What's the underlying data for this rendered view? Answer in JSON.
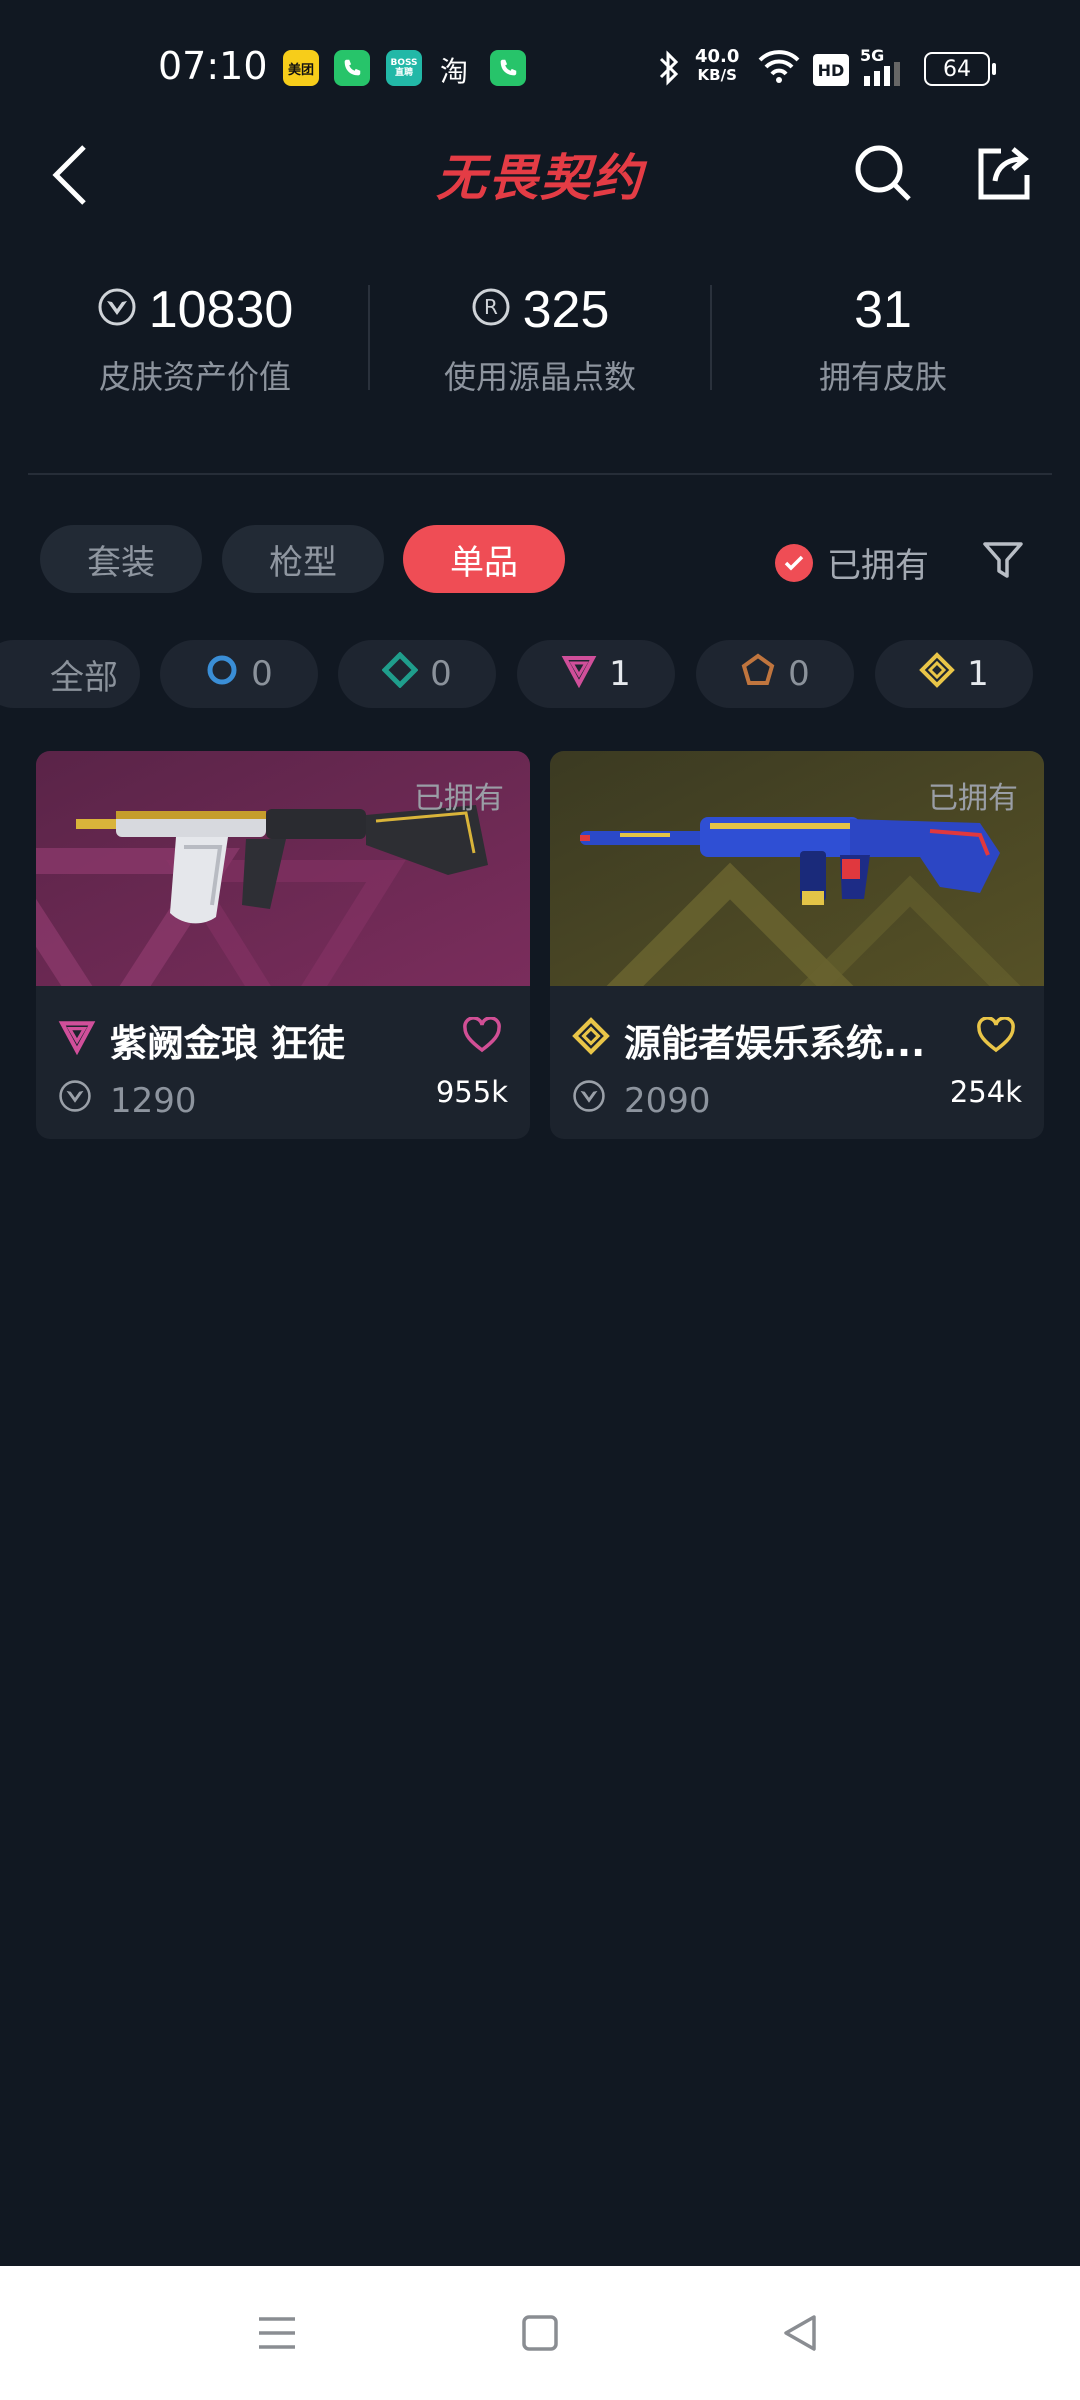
{
  "status_bar": {
    "time": "07:10",
    "apps": [
      "美团",
      "BOSS直聘",
      "淘"
    ],
    "net_speed": "40.0",
    "net_unit": "KB/S",
    "hd": "HD",
    "signal": "5G",
    "battery": "64"
  },
  "header": {
    "title": "无畏契约",
    "icons": [
      "back-icon",
      "search-icon",
      "share-icon"
    ]
  },
  "stats": [
    {
      "value": "10830",
      "label": "皮肤资产价值",
      "icon": "vp-icon"
    },
    {
      "value": "325",
      "label": "使用源晶点数",
      "icon": "radianite-icon"
    },
    {
      "value": "31",
      "label": "拥有皮肤"
    }
  ],
  "tabs": [
    {
      "label": "套装",
      "active": false
    },
    {
      "label": "枪型",
      "active": false
    },
    {
      "label": "单品",
      "active": true
    }
  ],
  "owned_filter": {
    "label": "已拥有",
    "checked": true
  },
  "rarity_filters": [
    {
      "label": "全部",
      "icon": ""
    },
    {
      "label": "0",
      "icon": "select-edition-icon",
      "color": "#3a8ed6"
    },
    {
      "label": "0",
      "icon": "deluxe-edition-icon",
      "color": "#1f9e8c"
    },
    {
      "label": "1",
      "icon": "premium-edition-icon",
      "color": "#d04f9a"
    },
    {
      "label": "0",
      "icon": "exclusive-edition-icon",
      "color": "#c0753e"
    },
    {
      "label": "1",
      "icon": "ultra-edition-icon",
      "color": "#e9c548"
    }
  ],
  "skins": [
    {
      "name": "紫阙金琅 狂徒",
      "price": "1290",
      "likes": "955k",
      "owned_label": "已拥有",
      "rarity_color": "#d04f9a",
      "heart_color": "#d14f95"
    },
    {
      "name": "源能者娱乐系统...",
      "price": "2090",
      "likes": "254k",
      "owned_label": "已拥有",
      "rarity_color": "#e9c548",
      "heart_color": "#e9c548"
    }
  ],
  "bottom_nav": [
    "menu-icon",
    "home-icon",
    "back-triangle-icon"
  ]
}
